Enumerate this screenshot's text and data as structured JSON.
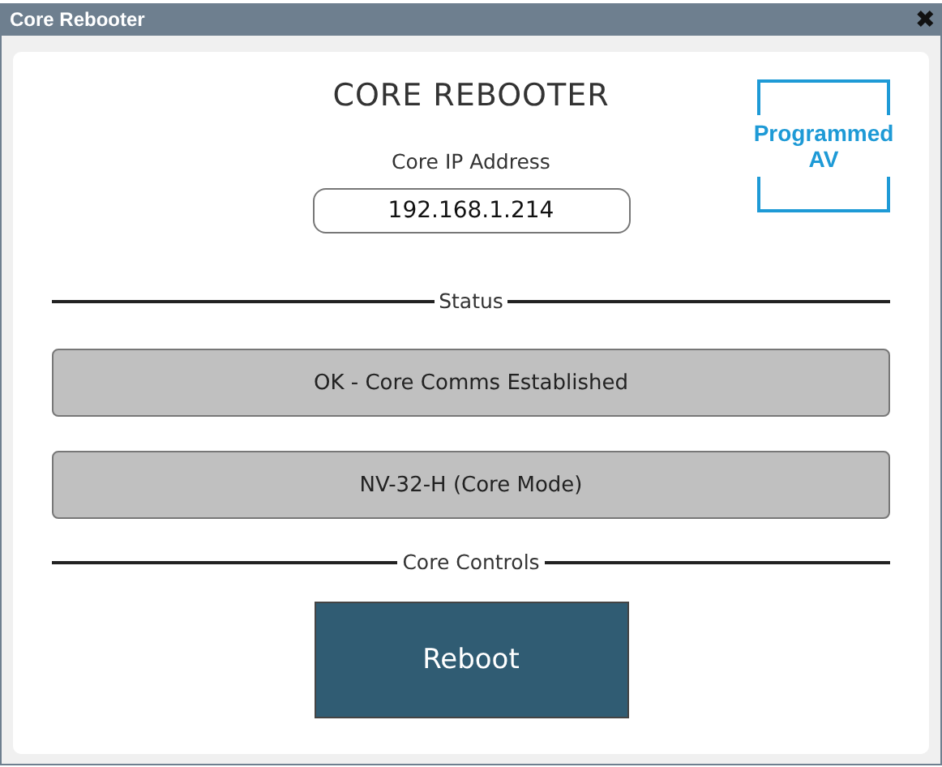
{
  "window": {
    "title": "Core Rebooter",
    "close": "✖"
  },
  "heading": "CORE REBOOTER",
  "logo": {
    "lines": [
      "Programmed",
      "AV"
    ]
  },
  "ip": {
    "label": "Core IP Address",
    "value": "192.168.1.214"
  },
  "sections": [
    {
      "title": "Status",
      "items": [
        {
          "kind": "status",
          "text": "OK - Core Comms Established"
        },
        {
          "kind": "status",
          "text": "NV-32-H (Core Mode)"
        }
      ]
    },
    {
      "title": "Core Controls",
      "items": [
        {
          "kind": "button",
          "text": "Reboot"
        }
      ]
    }
  ]
}
